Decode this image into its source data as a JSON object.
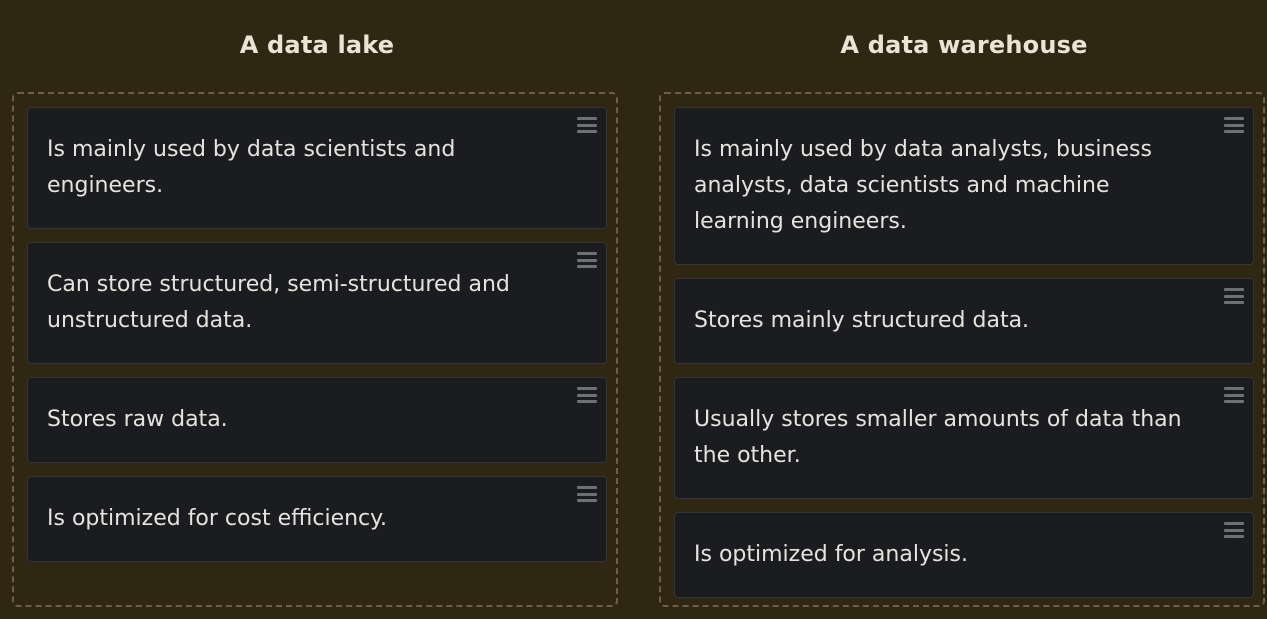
{
  "columns": [
    {
      "title": "A data lake",
      "items": [
        {
          "text": "Is mainly used by data scientists and engineers."
        },
        {
          "text": "Can store structured, semi-structured and unstructured data."
        },
        {
          "text": "Stores raw data."
        },
        {
          "text": "Is optimized for cost efficiency."
        }
      ]
    },
    {
      "title": "A data warehouse",
      "items": [
        {
          "text": "Is mainly used by data analysts, business analysts, data scientists and machine learning engineers."
        },
        {
          "text": "Stores mainly structured data."
        },
        {
          "text": "Usually stores smaller amounts of data than the other."
        },
        {
          "text": "Is optimized for analysis."
        }
      ]
    }
  ],
  "icons": {
    "drag_handle": "drag-handle-icon"
  }
}
